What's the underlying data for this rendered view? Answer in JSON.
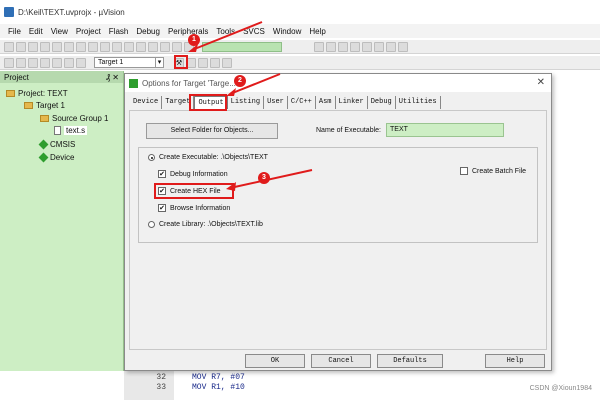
{
  "window": {
    "title": "D:\\Keil\\TEXT.uvprojx - µVision"
  },
  "menubar": [
    "File",
    "Edit",
    "View",
    "Project",
    "Flash",
    "Debug",
    "Peripherals",
    "Tools",
    "SVCS",
    "Window",
    "Help"
  ],
  "toolbar": {
    "target_select": "Target 1"
  },
  "project_panel": {
    "header": "Project",
    "pin": "₰ ✕",
    "tree": {
      "project": "Project: TEXT",
      "target": "Target 1",
      "group": "Source Group 1",
      "file": "text.s",
      "cmsis": "CMSIS",
      "device": "Device"
    }
  },
  "dialog": {
    "title": "Options for Target 'Targe...",
    "close": "✕",
    "tabs": [
      "Device",
      "Target",
      "Output",
      "Listing",
      "User",
      "C/C++",
      "Asm",
      "Linker",
      "Debug",
      "Utilities"
    ],
    "active_tab": "Output",
    "select_folder_button": "Select Folder for Objects...",
    "name_of_executable_label": "Name of Executable:",
    "name_of_executable_value": "TEXT",
    "create_executable_label": "Create Executable: .\\Objects\\TEXT",
    "debug_information": "Debug Information",
    "create_hex_file": "Create HEX File",
    "browse_information": "Browse Information",
    "create_library_label": "Create Library: .\\Objects\\TEXT.lib",
    "create_batch_file": "Create Batch File",
    "checkmark": "✔",
    "buttons": {
      "ok": "OK",
      "cancel": "Cancel",
      "defaults": "Defaults",
      "help": "Help"
    }
  },
  "annotations": {
    "badge1": "1",
    "badge2": "2",
    "badge3": "3"
  },
  "editor": {
    "line_numbers": [
      "32",
      "33"
    ],
    "lines": [
      "MOV R7, #07",
      "MOV R1, #10"
    ]
  },
  "watermark": "CSDN @Xioun1984",
  "colors": {
    "accent_red": "#e01b1b",
    "panel_green": "#cdeec4"
  }
}
